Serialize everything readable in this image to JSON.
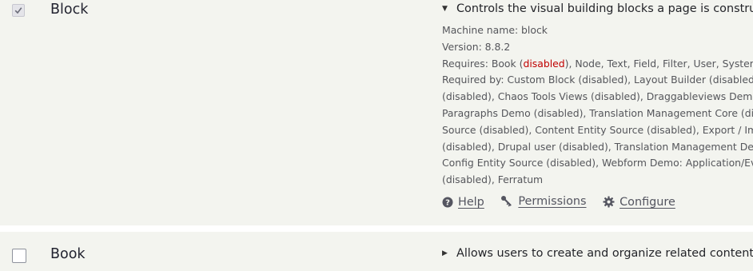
{
  "modules": [
    {
      "name": "Block",
      "checked": true,
      "summary": "Controls the visual building blocks a page is construc",
      "expanded": true,
      "details": {
        "machine_name": "Machine name: block",
        "version": "Version: 8.8.2",
        "requires_prefix": "Requires: Book (",
        "requires_disabled": "disabled",
        "requires_suffix": "), Node, Text, Field, Filter, User, System",
        "required_by_lines": [
          "Required by: Custom Block (disabled), Layout Builder (disabled),",
          "(disabled), Chaos Tools Views (disabled), Draggableviews Demo (",
          "Paragraphs Demo (disabled), Translation Management Core (dis",
          "Source (disabled), Content Entity Source (disabled), Export / Imp",
          "(disabled), Drupal user (disabled), Translation Management Dem",
          "Config Entity Source (disabled), Webform Demo: Application/Eva",
          "(disabled), Ferratum"
        ]
      },
      "links": {
        "help": "Help",
        "permissions": "Permissions",
        "configure": "Configure"
      }
    },
    {
      "name": "Book",
      "checked": false,
      "summary": "Allows users to create and organize related content i",
      "expanded": false
    }
  ],
  "colors": {
    "row_background": "#f3f4ef",
    "disabled_text": "#c00000",
    "detail_text": "#55565b"
  }
}
